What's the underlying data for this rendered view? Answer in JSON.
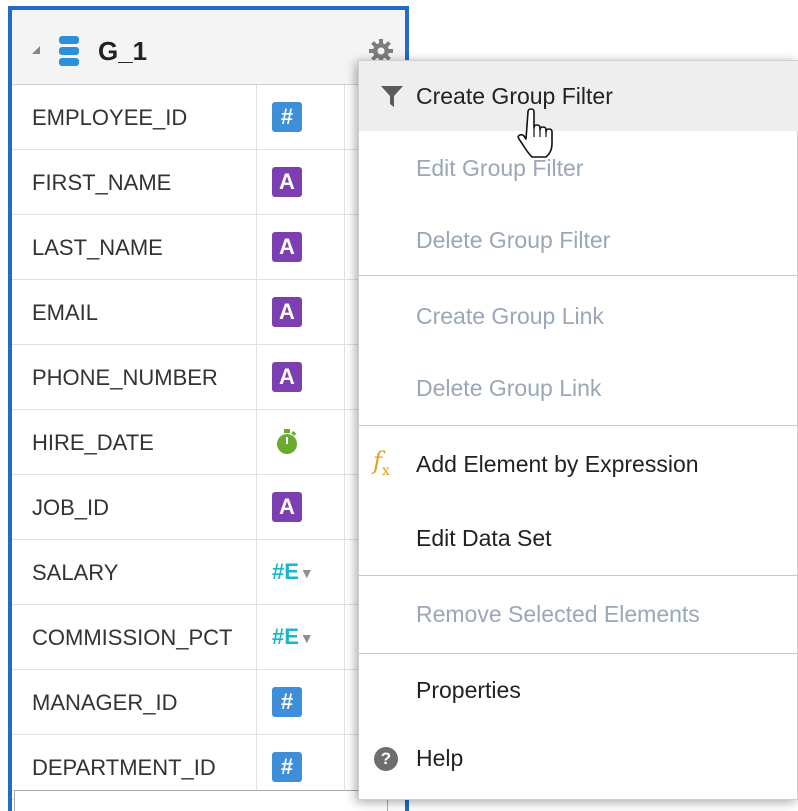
{
  "group": {
    "title": "G_1",
    "icons": {
      "collapse": "collapse-triangle-icon",
      "dataset": "database-icon",
      "settings": "gear-icon"
    }
  },
  "elements": [
    {
      "name": "EMPLOYEE_ID",
      "type": "number"
    },
    {
      "name": "FIRST_NAME",
      "type": "string"
    },
    {
      "name": "LAST_NAME",
      "type": "string"
    },
    {
      "name": "EMAIL",
      "type": "string"
    },
    {
      "name": "PHONE_NUMBER",
      "type": "string"
    },
    {
      "name": "HIRE_DATE",
      "type": "date"
    },
    {
      "name": "JOB_ID",
      "type": "string"
    },
    {
      "name": "SALARY",
      "type": "number-aggregate"
    },
    {
      "name": "COMMISSION_PCT",
      "type": "number-aggregate"
    },
    {
      "name": "MANAGER_ID",
      "type": "number"
    },
    {
      "name": "DEPARTMENT_ID",
      "type": "number"
    }
  ],
  "type_glyphs": {
    "number": "#",
    "string": "A",
    "number_aggregate": "#E",
    "dropdown": "▼"
  },
  "menu": {
    "items": [
      {
        "label": "Create Group Filter",
        "enabled": true,
        "hover": true,
        "icon": "filter-icon"
      },
      {
        "label": "Edit Group Filter",
        "enabled": false
      },
      {
        "label": "Delete Group Filter",
        "enabled": false
      },
      {
        "label": "Create Group Link",
        "enabled": false
      },
      {
        "label": "Delete Group Link",
        "enabled": false
      },
      {
        "label": "Add Element by Expression",
        "enabled": true,
        "icon": "fx-icon"
      },
      {
        "label": "Edit Data Set",
        "enabled": true
      },
      {
        "label": "Remove Selected Elements",
        "enabled": false
      },
      {
        "label": "Properties",
        "enabled": true
      },
      {
        "label": "Help",
        "enabled": true,
        "icon": "help-icon"
      }
    ],
    "fx_glyph": "f",
    "fx_sub": "x",
    "help_glyph": "?"
  },
  "colors": {
    "accent_border": "#1f6dc5",
    "number_icon": "#3f8ed8",
    "string_icon": "#7b3fb2",
    "date_icon": "#6aab2e",
    "expression_icon": "#18b6c9",
    "disabled_text": "#9aa7b6"
  }
}
